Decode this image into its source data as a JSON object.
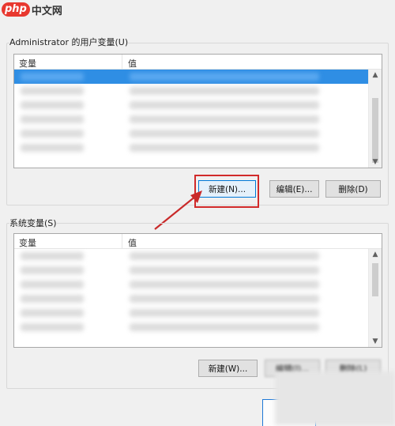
{
  "logo": {
    "mark": "php",
    "text": "中文网"
  },
  "user_vars": {
    "title": "Administrator 的用户变量(U)",
    "columns": {
      "variable": "变量",
      "value": "值"
    },
    "rows": [
      {
        "selected": true
      },
      {
        "selected": false
      },
      {
        "selected": false
      },
      {
        "selected": false
      },
      {
        "selected": false
      },
      {
        "selected": false
      }
    ],
    "buttons": {
      "new": "新建(N)...",
      "edit": "编辑(E)...",
      "delete": "删除(D)"
    }
  },
  "sys_vars": {
    "title": "系统变量(S)",
    "columns": {
      "variable": "变量",
      "value": "值"
    },
    "rows": [
      {
        "selected": false
      },
      {
        "selected": false
      },
      {
        "selected": false
      },
      {
        "selected": false
      },
      {
        "selected": false
      },
      {
        "selected": false
      }
    ],
    "buttons": {
      "new": "新建(W)...",
      "edit": "编辑(I)...",
      "delete": "删除(L)"
    }
  },
  "icons": {
    "scroll_up": "triangle-up-icon",
    "scroll_down": "triangle-down-icon"
  },
  "colors": {
    "selection": "#2f8ee4",
    "highlight": "#d12a2a",
    "focus": "#0078d7"
  }
}
